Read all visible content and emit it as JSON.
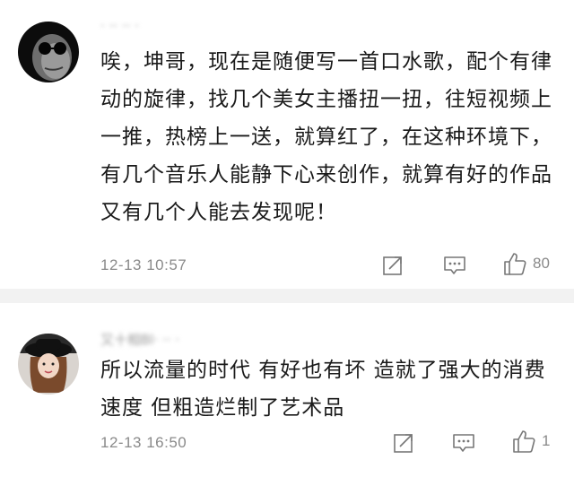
{
  "comments": [
    {
      "username": "· ·· ·· ·",
      "text": "唉，坤哥，现在是随便写一首口水歌，配个有律动的旋律，找几个美女主播扭一扭，往短视频上一推，热榜上一送，就算红了，在这种环境下，有几个音乐人能静下心来创作，就算有好的作品又有几个人能去发现呢！",
      "time": "12-13 10:57",
      "likes": "80",
      "avatar_icon": "sunglasses-man-avatar"
    },
    {
      "username": "又十相Bl· ·· ·",
      "text": "所以流量的时代 有好也有坏 造就了强大的消费速度 但粗造烂制了艺术品",
      "time": "12-13 16:50",
      "likes": "1",
      "avatar_icon": "girl-black-hat-avatar"
    }
  ]
}
